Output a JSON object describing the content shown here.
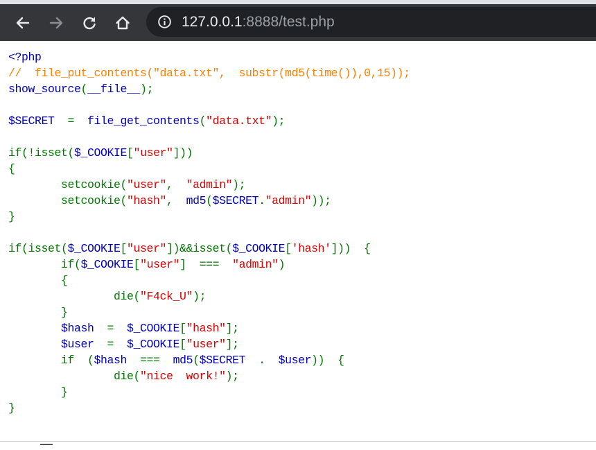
{
  "browser": {
    "url_host": "127.0.0.1",
    "url_rest": ":8888/test.php",
    "icons": {
      "back": "back-arrow-icon",
      "forward": "forward-arrow-icon",
      "reload": "reload-icon",
      "home": "home-icon",
      "info": "info-icon"
    },
    "colors": {
      "toolbar": "#35363a",
      "omnibox": "#202124"
    }
  },
  "source": {
    "lines": [
      [
        {
          "t": "d",
          "v": "<?php"
        }
      ],
      [
        {
          "t": "c",
          "v": "//  file_put_contents(\"data.txt\",  substr(md5(time()),0,15));"
        }
      ],
      [
        {
          "t": "d",
          "v": "show_source"
        },
        {
          "t": "k",
          "v": "("
        },
        {
          "t": "d",
          "v": "__file__"
        },
        {
          "t": "k",
          "v": ");"
        }
      ],
      [],
      [
        {
          "t": "d",
          "v": "$SECRET  "
        },
        {
          "t": "k",
          "v": "=  "
        },
        {
          "t": "d",
          "v": "file_get_contents"
        },
        {
          "t": "k",
          "v": "("
        },
        {
          "t": "s",
          "v": "\"data.txt\""
        },
        {
          "t": "k",
          "v": ");"
        }
      ],
      [],
      [
        {
          "t": "k",
          "v": "if(!isset("
        },
        {
          "t": "d",
          "v": "$_COOKIE"
        },
        {
          "t": "k",
          "v": "["
        },
        {
          "t": "s",
          "v": "\"user\""
        },
        {
          "t": "k",
          "v": "]))"
        }
      ],
      [
        {
          "t": "k",
          "v": "{"
        }
      ],
      [
        {
          "t": "k",
          "v": "        setcookie("
        },
        {
          "t": "s",
          "v": "\"user\""
        },
        {
          "t": "k",
          "v": ",  "
        },
        {
          "t": "s",
          "v": "\"admin\""
        },
        {
          "t": "k",
          "v": ");"
        }
      ],
      [
        {
          "t": "k",
          "v": "        setcookie("
        },
        {
          "t": "s",
          "v": "\"hash\""
        },
        {
          "t": "k",
          "v": ",  "
        },
        {
          "t": "d",
          "v": "md5"
        },
        {
          "t": "k",
          "v": "("
        },
        {
          "t": "d",
          "v": "$SECRET"
        },
        {
          "t": "k",
          "v": "."
        },
        {
          "t": "s",
          "v": "\"admin\""
        },
        {
          "t": "k",
          "v": "));"
        }
      ],
      [
        {
          "t": "k",
          "v": "}"
        }
      ],
      [],
      [
        {
          "t": "k",
          "v": "if(isset("
        },
        {
          "t": "d",
          "v": "$_COOKIE"
        },
        {
          "t": "k",
          "v": "["
        },
        {
          "t": "s",
          "v": "\"user\""
        },
        {
          "t": "k",
          "v": "])&&isset("
        },
        {
          "t": "d",
          "v": "$_COOKIE"
        },
        {
          "t": "k",
          "v": "["
        },
        {
          "t": "s",
          "v": "'hash'"
        },
        {
          "t": "k",
          "v": "]))  {"
        }
      ],
      [
        {
          "t": "k",
          "v": "        if("
        },
        {
          "t": "d",
          "v": "$_COOKIE"
        },
        {
          "t": "k",
          "v": "["
        },
        {
          "t": "s",
          "v": "\"user\""
        },
        {
          "t": "k",
          "v": "]  ===  "
        },
        {
          "t": "s",
          "v": "\"admin\""
        },
        {
          "t": "k",
          "v": ")"
        }
      ],
      [
        {
          "t": "k",
          "v": "        {"
        }
      ],
      [
        {
          "t": "k",
          "v": "                die("
        },
        {
          "t": "s",
          "v": "\"F4ck_U\""
        },
        {
          "t": "k",
          "v": ");"
        }
      ],
      [
        {
          "t": "k",
          "v": "        }"
        }
      ],
      [
        {
          "t": "d",
          "v": "        $hash  "
        },
        {
          "t": "k",
          "v": "=  "
        },
        {
          "t": "d",
          "v": "$_COOKIE"
        },
        {
          "t": "k",
          "v": "["
        },
        {
          "t": "s",
          "v": "\"hash\""
        },
        {
          "t": "k",
          "v": "];"
        }
      ],
      [
        {
          "t": "d",
          "v": "        $user  "
        },
        {
          "t": "k",
          "v": "=  "
        },
        {
          "t": "d",
          "v": "$_COOKIE"
        },
        {
          "t": "k",
          "v": "["
        },
        {
          "t": "s",
          "v": "\"user\""
        },
        {
          "t": "k",
          "v": "];"
        }
      ],
      [
        {
          "t": "k",
          "v": "        if  ("
        },
        {
          "t": "d",
          "v": "$hash  "
        },
        {
          "t": "k",
          "v": "===  "
        },
        {
          "t": "d",
          "v": "md5"
        },
        {
          "t": "k",
          "v": "("
        },
        {
          "t": "d",
          "v": "$SECRET  "
        },
        {
          "t": "k",
          "v": ".  "
        },
        {
          "t": "d",
          "v": "$user"
        },
        {
          "t": "k",
          "v": "))  {"
        }
      ],
      [
        {
          "t": "k",
          "v": "                die("
        },
        {
          "t": "s",
          "v": "\"nice  work!\""
        },
        {
          "t": "k",
          "v": ");"
        }
      ],
      [
        {
          "t": "k",
          "v": "        }"
        }
      ],
      [
        {
          "t": "k",
          "v": "}"
        }
      ]
    ]
  }
}
